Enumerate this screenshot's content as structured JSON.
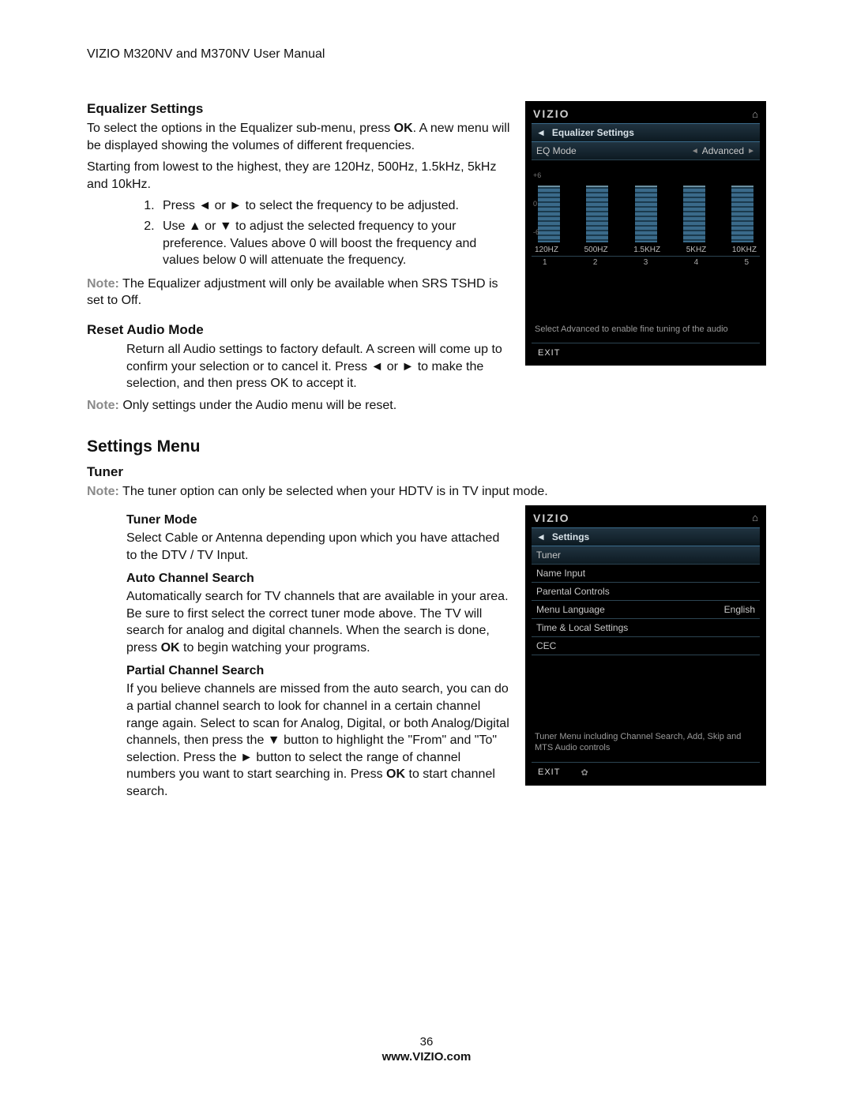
{
  "doc_title": "VIZIO M320NV and M370NV User Manual",
  "eq_section": {
    "heading": "Equalizer Settings",
    "p1a": "To select the options in the Equalizer sub-menu, press ",
    "p1b": "OK",
    "p1c": ". A new menu will be displayed showing the volumes of different frequencies.",
    "p2": "Starting from lowest to the highest, they are 120Hz, 500Hz, 1.5kHz, 5kHz and 10kHz.",
    "li1": "Press ◄ or ► to select the frequency to be adjusted.",
    "li2": "Use ▲ or ▼ to adjust the selected frequency to your preference. Values above 0 will boost the frequency and values below 0 will attenuate the frequency.",
    "note_label": "Note:",
    "note_text": " The Equalizer adjustment will only be available when SRS TSHD is set to Off."
  },
  "reset_section": {
    "heading": "Reset Audio Mode",
    "p1": "Return all Audio settings to factory default. A screen will come up to confirm your selection or to cancel it. Press ◄ or ► to make the selection, and then press OK to accept it.",
    "note_label": "Note:",
    "note_text": " Only settings under the Audio menu will be reset."
  },
  "settings_menu_heading": "Settings Menu",
  "tuner_section": {
    "heading": "Tuner",
    "note_label": "Note:",
    "note_text": " The tuner option can only be selected when your HDTV is in TV input mode.",
    "tuner_mode": {
      "heading": "Tuner Mode",
      "body": "Select Cable or Antenna depending upon which you have attached to the DTV / TV Input."
    },
    "auto_search": {
      "heading": "Auto Channel Search",
      "body_a": "Automatically search for TV channels that are available in your area. Be sure to first select the correct tuner mode above. The TV will search for analog and digital channels. When the search is done, press ",
      "body_b": "OK",
      "body_c": " to begin watching your programs."
    },
    "partial_search": {
      "heading": "Partial Channel Search",
      "body_a": "If you believe channels are missed from the auto search, you can do a partial channel search to look for channel in a certain channel range again. Select to scan for Analog, Digital, or both Analog/Digital channels, then press the ▼ button to highlight the \"From\" and \"To\" selection. Press the ► button to select the range of channel numbers you want to start searching in. Press ",
      "body_b": "OK",
      "body_c": " to start channel search."
    }
  },
  "osd1": {
    "brand": "VIZIO",
    "title": "Equalizer Settings",
    "eq_mode_label": "EQ Mode",
    "eq_mode_value": "Advanced",
    "freqs": [
      "120HZ",
      "500HZ",
      "1.5KHZ",
      "5KHZ",
      "10KHZ"
    ],
    "nums": [
      "1",
      "2",
      "3",
      "4",
      "5"
    ],
    "scale": [
      "+6",
      "0",
      "-6"
    ],
    "hint": "Select Advanced to enable fine tuning of the audio",
    "exit": "EXIT"
  },
  "osd2": {
    "brand": "VIZIO",
    "title": "Settings",
    "items": [
      {
        "label": "Tuner",
        "value": ""
      },
      {
        "label": "Name Input",
        "value": ""
      },
      {
        "label": "Parental Controls",
        "value": ""
      },
      {
        "label": "Menu Language",
        "value": "English"
      },
      {
        "label": "Time & Local Settings",
        "value": ""
      },
      {
        "label": "CEC",
        "value": ""
      }
    ],
    "hint": "Tuner Menu including Channel Search, Add, Skip and MTS Audio controls",
    "exit": "EXIT"
  },
  "footer": {
    "page_num": "36",
    "site": "www.VIZIO.com"
  }
}
